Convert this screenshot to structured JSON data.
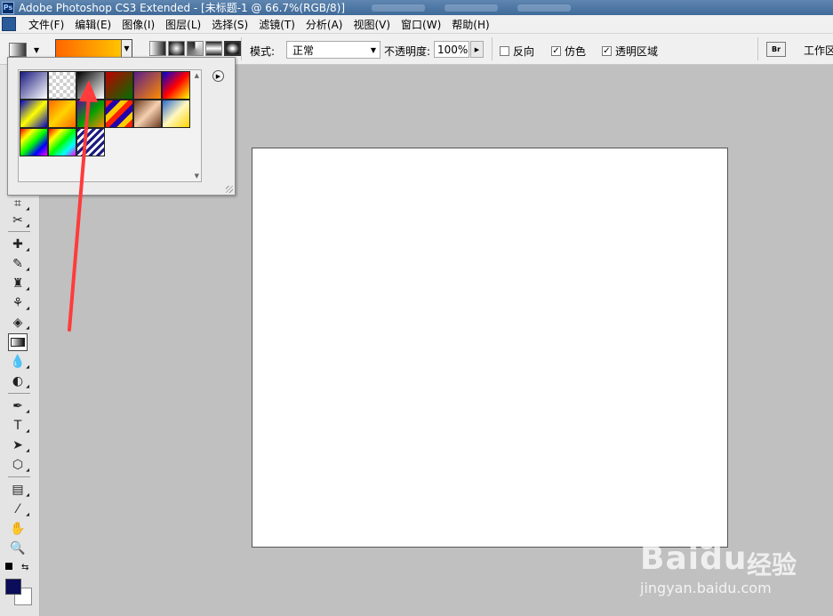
{
  "window": {
    "title": "Adobe Photoshop CS3 Extended - [未标题-1 @ 66.7%(RGB/8)]",
    "app_icon": "ps-logo-icon"
  },
  "menubar": {
    "items": [
      "文件(F)",
      "编辑(E)",
      "图像(I)",
      "图层(L)",
      "选择(S)",
      "滤镜(T)",
      "分析(A)",
      "视图(V)",
      "窗口(W)",
      "帮助(H)"
    ]
  },
  "options": {
    "mode_label": "模式:",
    "mode_value": "正常",
    "opacity_label": "不透明度:",
    "opacity_value": "100%",
    "reverse_label": "反向",
    "reverse_checked": false,
    "dither_label": "仿色",
    "dither_checked": true,
    "transparency_label": "透明区域",
    "transparency_checked": true,
    "workspace_label": "工作区",
    "bridge_icon": "bridge-icon",
    "current_gradient": [
      "#ff6600",
      "#ffd400"
    ]
  },
  "gradient_presets": [
    "linear-gradient(135deg,#1a1a80,#ffffff)",
    "repeating-conic-gradient(#cfcfcf 0 25%,#ffffff 0 50%) 0 0/8px 8px",
    "linear-gradient(135deg,#000000,#ffffff)",
    "linear-gradient(135deg,#c00000,#007000)",
    "linear-gradient(135deg,#5b1e8a,#ff8c00)",
    "linear-gradient(135deg,#0000dd,#ff0000,#ffff00)",
    "linear-gradient(135deg,#0000cc,#ffff00,#0000cc)",
    "linear-gradient(135deg,#ff6600,#ffd400,#ff6600)",
    "linear-gradient(135deg,#6a00a0,#00a000,#ff8c00)",
    "repeating-linear-gradient(135deg,#ff2200 0 6px,#2200aa 6px 12px,#ffcc00 12px 18px)",
    "linear-gradient(135deg,#6b3a1e,#f5d0b0,#6b3a1e)",
    "linear-gradient(135deg,#2a6ad0,#fff7c0,#ffd400)",
    "linear-gradient(135deg,#ff0000,#ffff00,#00ff00,#0000ff,#ff00ff)",
    "linear-gradient(135deg,#ff0000,#ffff00,#00ff00,#00ffff,#ff00ff)",
    "repeating-linear-gradient(135deg,#1a1a80 0 3px,#ffffff 3px 6px)"
  ],
  "toolbox": {
    "tools": [
      "crop-icon",
      "slice-icon",
      "healing-brush-icon",
      "brush-icon",
      "clone-stamp-icon",
      "history-brush-icon",
      "eraser-icon",
      "gradient-icon",
      "blur-icon",
      "dodge-icon",
      "pen-icon",
      "type-icon",
      "path-selection-icon",
      "shape-icon",
      "notes-icon",
      "eyedropper-icon",
      "hand-icon",
      "zoom-icon"
    ],
    "active_tool": "gradient-icon",
    "foreground_color": "#0b0c5a",
    "background_color": "#ffffff"
  },
  "canvas": {
    "background": "#ffffff"
  },
  "watermark": {
    "brand": "Bai",
    "brand2": "du",
    "cn": "经验",
    "url": "jingyan.baidu.com"
  },
  "annotation": {
    "color": "#ff3b3b"
  }
}
